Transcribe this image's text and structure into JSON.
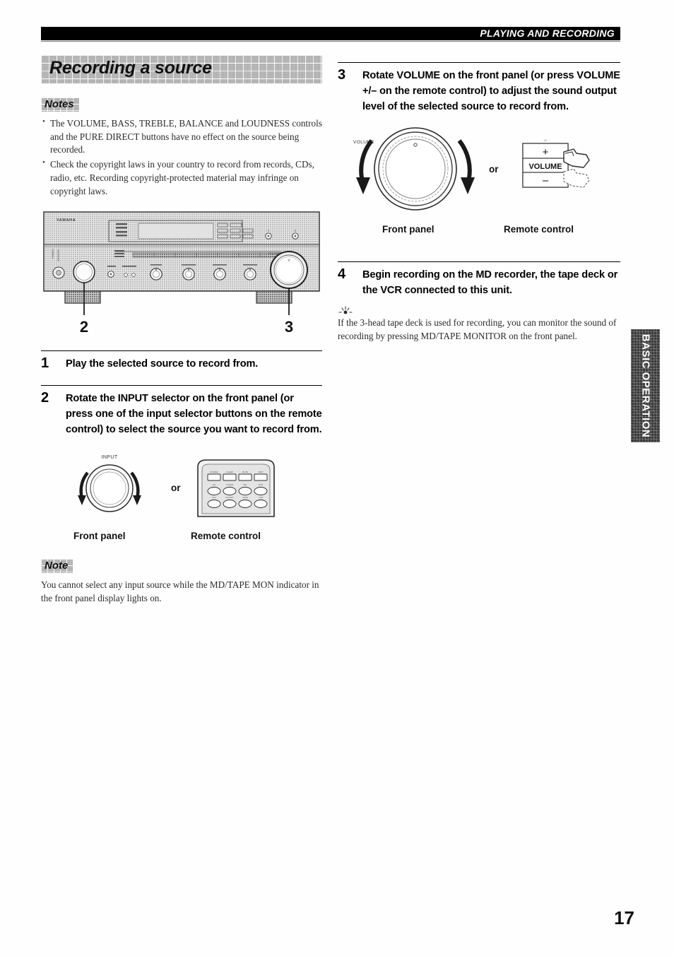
{
  "header": {
    "title": "PLAYING AND RECORDING"
  },
  "section": {
    "title": "Recording a source"
  },
  "notes_block": {
    "label": "Notes",
    "items": [
      "The VOLUME, BASS, TREBLE, BALANCE and LOUDNESS controls and the PURE DIRECT buttons have no effect on the source being recorded.",
      "Check the copyright laws in your country to record from records, CDs, radio, etc. Recording copyright-protected material may infringe on copyright laws."
    ]
  },
  "receiver_figure": {
    "brand": "YAMAHA",
    "callout_left": "2",
    "callout_right": "3"
  },
  "steps": [
    {
      "number": "1",
      "text": "Play the selected source to record from."
    },
    {
      "number": "2",
      "text": "Rotate the INPUT selector on the front panel (or press one of the input selector buttons on the remote control) to select the source you want to record from."
    },
    {
      "number": "3",
      "text": "Rotate VOLUME on the front panel (or press VOLUME +/– on the remote control) to adjust the sound output level of the selected source to record from."
    },
    {
      "number": "4",
      "text": "Begin recording on the MD recorder, the tape deck or the VCR connected to this unit."
    }
  ],
  "input_figure": {
    "knob_label": "INPUT",
    "or": "or",
    "caption_left": "Front panel",
    "caption_right": "Remote control"
  },
  "volume_figure": {
    "knob_label": "VOLUME",
    "or": "or",
    "caption_left": "Front panel",
    "caption_right": "Remote control",
    "remote_plus": "+",
    "remote_label": "VOLUME",
    "remote_minus": "–"
  },
  "note_block": {
    "label": "Note",
    "text": "You cannot select any input source while the MD/TAPE MON indicator in the front panel display lights on."
  },
  "tip_block": {
    "glyph": "☆",
    "text": "If the 3-head tape deck is used for recording, you can monitor the sound of recording by pressing MD/TAPE MONITOR on the front panel."
  },
  "side_tab": {
    "label": "BASIC OPERATION"
  },
  "page_number": "17"
}
